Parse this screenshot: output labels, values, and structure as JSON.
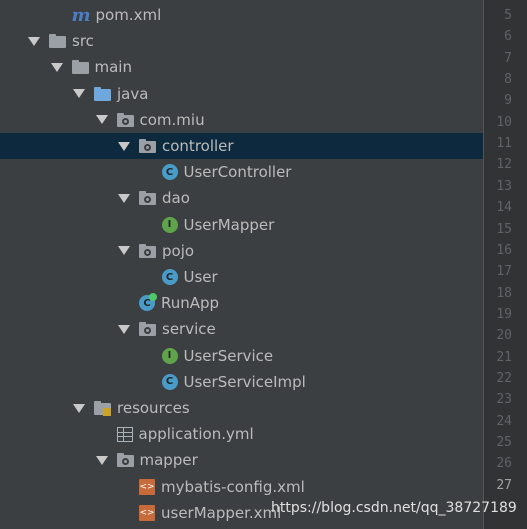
{
  "tree": [
    {
      "label": "pom.xml",
      "depth": 1,
      "icon": "maven-icon",
      "arrow": false
    },
    {
      "label": "src",
      "depth": 0,
      "icon": "folder-icon",
      "arrow": true
    },
    {
      "label": "main",
      "depth": 1,
      "icon": "folder-icon",
      "arrow": true
    },
    {
      "label": "java",
      "depth": 2,
      "icon": "source-folder-icon",
      "arrow": true
    },
    {
      "label": "com.miu",
      "depth": 3,
      "icon": "package-icon",
      "arrow": true
    },
    {
      "label": "controller",
      "depth": 4,
      "icon": "package-icon",
      "arrow": true,
      "selected": true
    },
    {
      "label": "UserController",
      "depth": 5,
      "icon": "class-icon",
      "arrow": false
    },
    {
      "label": "dao",
      "depth": 4,
      "icon": "package-icon",
      "arrow": true
    },
    {
      "label": "UserMapper",
      "depth": 5,
      "icon": "interface-icon",
      "arrow": false
    },
    {
      "label": "pojo",
      "depth": 4,
      "icon": "package-icon",
      "arrow": true
    },
    {
      "label": "User",
      "depth": 5,
      "icon": "class-icon",
      "arrow": false
    },
    {
      "label": "RunApp",
      "depth": 4,
      "icon": "runnable-class-icon",
      "arrow": false
    },
    {
      "label": "service",
      "depth": 4,
      "icon": "package-icon",
      "arrow": true
    },
    {
      "label": "UserService",
      "depth": 5,
      "icon": "interface-icon",
      "arrow": false
    },
    {
      "label": "UserServiceImpl",
      "depth": 5,
      "icon": "class-icon",
      "arrow": false
    },
    {
      "label": "resources",
      "depth": 2,
      "icon": "resources-folder-icon",
      "arrow": true
    },
    {
      "label": "application.yml",
      "depth": 3,
      "icon": "yml-file-icon",
      "arrow": false
    },
    {
      "label": "mapper",
      "depth": 3,
      "icon": "package-icon",
      "arrow": true
    },
    {
      "label": "mybatis-config.xml",
      "depth": 4,
      "icon": "xml-file-icon",
      "arrow": false
    },
    {
      "label": "userMapper.xml",
      "depth": 4,
      "icon": "xml-file-icon",
      "arrow": false
    }
  ],
  "line_numbers": [
    "5",
    "6",
    "7",
    "8",
    "9",
    "10",
    "11",
    "12",
    "13",
    "14",
    "15",
    "16",
    "17",
    "18",
    "19",
    "20",
    "21",
    "22",
    "23",
    "24",
    "25",
    "26",
    "27"
  ],
  "current_line": "27",
  "watermark": "https://blog.csdn.net/qq_38727189",
  "colors": {
    "background": "#3c3f41",
    "selected_row": "#0d293e",
    "class_icon": "#4a9cc8",
    "interface_icon": "#5fa34b"
  }
}
